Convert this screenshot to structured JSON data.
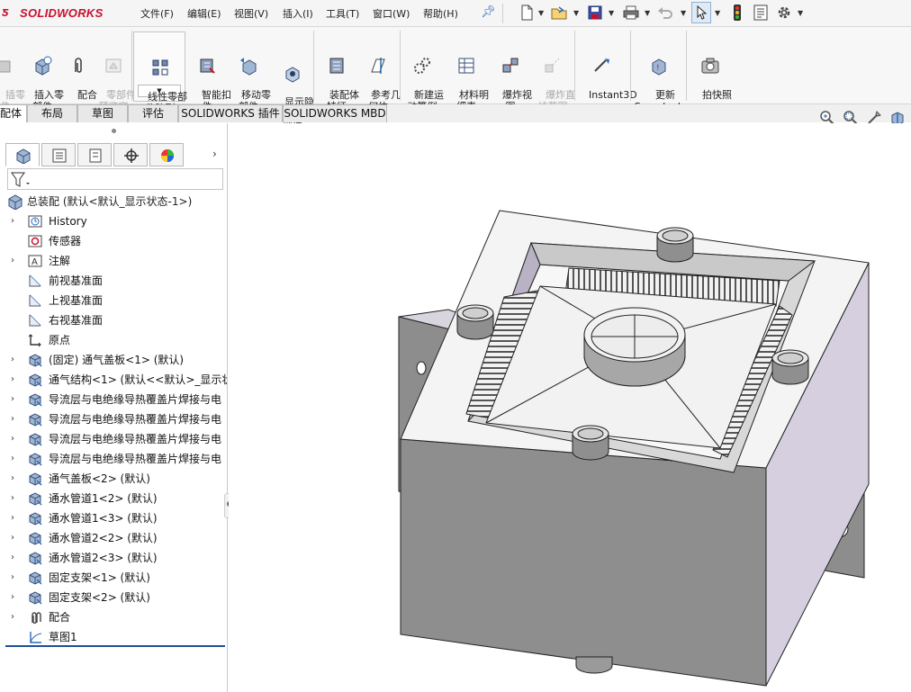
{
  "app": {
    "logo": "SOLIDWORKS"
  },
  "menu": {
    "items": [
      "文件(F)",
      "编辑(E)",
      "视图(V)",
      "插入(I)",
      "工具(T)",
      "窗口(W)",
      "帮助(H)"
    ]
  },
  "commands": {
    "items": [
      {
        "label": "插入零\n部件",
        "enabled": true
      },
      {
        "label": "配合",
        "enabled": true
      },
      {
        "label": "零部件\n预览窗\n口",
        "enabled": false
      },
      {
        "label": "线性零部\n件阵列",
        "enabled": true
      },
      {
        "label": "智能扣\n件",
        "enabled": true
      },
      {
        "label": "移动零\n部件",
        "enabled": true
      },
      {
        "label": "显示隐\n藏的零\n部件",
        "enabled": true
      },
      {
        "label": "装配体\n特征",
        "enabled": true
      },
      {
        "label": "参考几\n何体",
        "enabled": true
      },
      {
        "label": "新建运\n动算例",
        "enabled": true
      },
      {
        "label": "材料明\n细表",
        "enabled": true
      },
      {
        "label": "爆炸视\n图",
        "enabled": true
      },
      {
        "label": "爆炸直\n线草图",
        "enabled": false
      },
      {
        "label": "Instant3D",
        "enabled": true
      },
      {
        "label": "更新\nSpeedpak",
        "enabled": true
      },
      {
        "label": "拍快照",
        "enabled": true
      }
    ],
    "cut_off_left": "插零\n件"
  },
  "tabs": [
    "配体",
    "布局",
    "草图",
    "评估",
    "SOLIDWORKS 插件",
    "SOLIDWORKS MBD"
  ],
  "feature_manager": {
    "root": "总装配 (默认<默认_显示状态-1>)",
    "tree": [
      {
        "label": "History",
        "icon": "history-icon",
        "expandable": true
      },
      {
        "label": "传感器",
        "icon": "sensor-icon",
        "expandable": false
      },
      {
        "label": "注解",
        "icon": "annotation-icon",
        "expandable": true
      },
      {
        "label": "前视基准面",
        "icon": "plane-icon",
        "expandable": false
      },
      {
        "label": "上视基准面",
        "icon": "plane-icon",
        "expandable": false
      },
      {
        "label": "右视基准面",
        "icon": "plane-icon",
        "expandable": false
      },
      {
        "label": "原点",
        "icon": "origin-icon",
        "expandable": false
      },
      {
        "label": "(固定) 通气盖板<1> (默认)",
        "icon": "part-icon",
        "expandable": true
      },
      {
        "label": "通气结构<1> (默认<<默认>_显示状",
        "icon": "part-icon",
        "expandable": true
      },
      {
        "label": "导流层与电绝缘导热覆盖片焊接与电",
        "icon": "part-icon",
        "expandable": true
      },
      {
        "label": "导流层与电绝缘导热覆盖片焊接与电",
        "icon": "part-icon",
        "expandable": true
      },
      {
        "label": "导流层与电绝缘导热覆盖片焊接与电",
        "icon": "part-icon",
        "expandable": true
      },
      {
        "label": "导流层与电绝缘导热覆盖片焊接与电",
        "icon": "part-icon",
        "expandable": true
      },
      {
        "label": "通气盖板<2> (默认)",
        "icon": "part-icon",
        "expandable": true
      },
      {
        "label": "通水管道1<2> (默认)",
        "icon": "part-icon",
        "expandable": true
      },
      {
        "label": "通水管道1<3> (默认)",
        "icon": "part-icon",
        "expandable": true
      },
      {
        "label": "通水管道2<2> (默认)",
        "icon": "part-icon",
        "expandable": true
      },
      {
        "label": "通水管道2<3> (默认)",
        "icon": "part-icon",
        "expandable": true
      },
      {
        "label": "固定支架<1> (默认)",
        "icon": "part-icon",
        "expandable": true
      },
      {
        "label": "固定支架<2> (默认)",
        "icon": "part-icon",
        "expandable": true
      },
      {
        "label": "配合",
        "icon": "mates-icon",
        "expandable": true
      },
      {
        "label": "草图1",
        "icon": "sketch-icon",
        "expandable": false
      }
    ]
  },
  "colors": {
    "accent": "#1f4e9a",
    "logo_red": "#c8102e",
    "model_gray": "#8e8e8e",
    "model_side": "#d6cfdf"
  }
}
